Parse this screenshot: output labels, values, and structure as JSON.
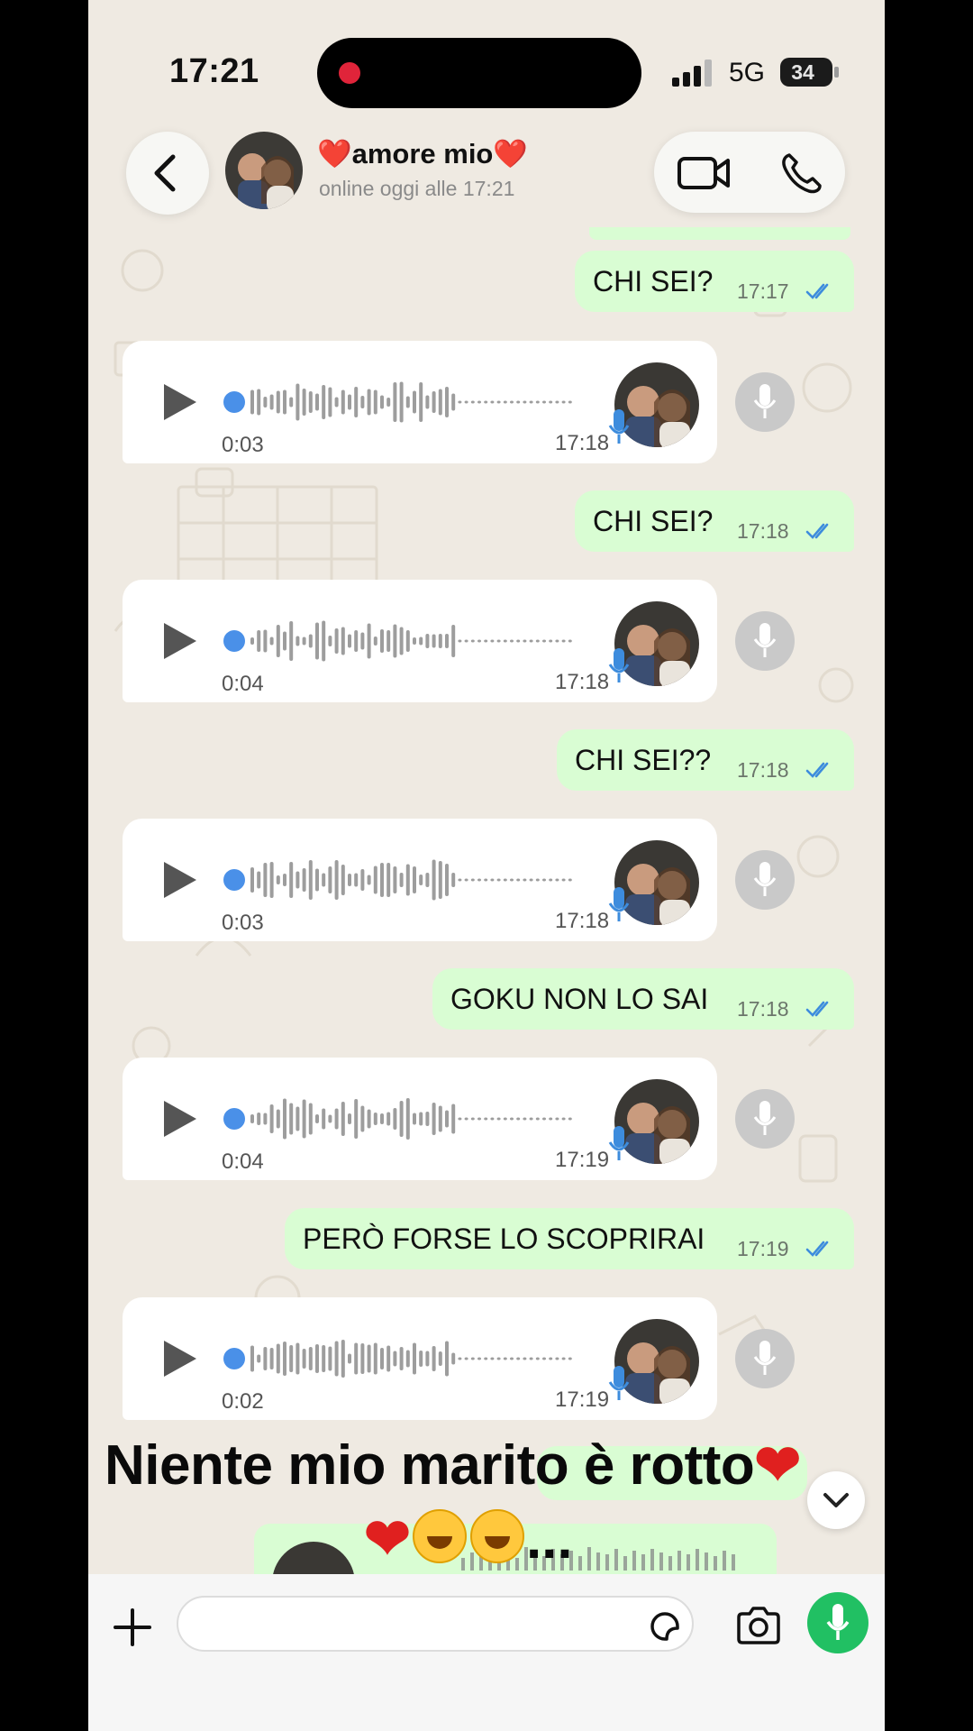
{
  "status_bar": {
    "time": "17:21",
    "network": "5G",
    "battery": "34"
  },
  "header": {
    "contact_name": "❤️amore mio❤️",
    "contact_status": "online oggi alle 17:21"
  },
  "messages": [
    {
      "type": "out",
      "text": "CHI SEI?",
      "time": "17:17"
    },
    {
      "type": "voice",
      "duration": "0:03",
      "time": "17:18"
    },
    {
      "type": "out",
      "text": "CHI SEI?",
      "time": "17:18"
    },
    {
      "type": "voice",
      "duration": "0:04",
      "time": "17:18"
    },
    {
      "type": "out",
      "text": "CHI SEI??",
      "time": "17:18"
    },
    {
      "type": "voice",
      "duration": "0:03",
      "time": "17:18"
    },
    {
      "type": "out",
      "text": "GOKU NON LO SAI",
      "time": "17:18"
    },
    {
      "type": "voice",
      "duration": "0:04",
      "time": "17:19"
    },
    {
      "type": "out",
      "text": "PERÒ FORSE LO SCOPRIRAI",
      "time": "17:19"
    },
    {
      "type": "voice",
      "duration": "0:02",
      "time": "17:19"
    }
  ],
  "overlay_caption": {
    "line1_text": "Niente mio marito è rotto",
    "line2_text": "..."
  },
  "input": {
    "placeholder": ""
  },
  "colors": {
    "outgoing_bubble": "#d9fdd3",
    "incoming_bubble": "#ffffff",
    "read_ticks": "#3d8cdd",
    "mic_button": "#21c063",
    "chat_bg": "#efeae2"
  },
  "icons": [
    "back-chevron-icon",
    "video-call-icon",
    "phone-call-icon",
    "play-icon",
    "microphone-icon",
    "double-check-icon",
    "plus-icon",
    "sticker-icon",
    "camera-icon",
    "chevron-down-icon"
  ]
}
